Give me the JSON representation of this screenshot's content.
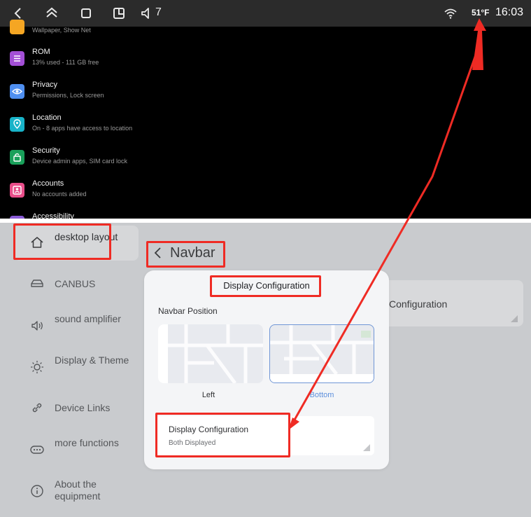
{
  "statusbar": {
    "volume_level": "7",
    "temperature": "51°F",
    "time": "16:03",
    "icons": [
      "back-icon",
      "collapse-icon",
      "recents-icon",
      "split-screen-icon",
      "volume-icon",
      "wifi-icon"
    ]
  },
  "settings_list": {
    "items": [
      {
        "title": "",
        "subtitle": "Wallpaper, Show Net",
        "icon": "display-icon",
        "color": "#f5a623"
      },
      {
        "title": "ROM",
        "subtitle": "13% used - 111 GB free",
        "icon": "storage-icon",
        "color": "#a34fd6"
      },
      {
        "title": "Privacy",
        "subtitle": "Permissions, Lock screen",
        "icon": "privacy-icon",
        "color": "#4f8ff0"
      },
      {
        "title": "Location",
        "subtitle": "On - 8 apps have access to location",
        "icon": "location-icon",
        "color": "#18b3c9"
      },
      {
        "title": "Security",
        "subtitle": "Device admin apps, SIM card lock",
        "icon": "security-icon",
        "color": "#19a05a"
      },
      {
        "title": "Accounts",
        "subtitle": "No accounts added",
        "icon": "accounts-icon",
        "color": "#e94e8a"
      },
      {
        "title": "Accessibility",
        "subtitle": "",
        "icon": "accessibility-icon",
        "color": "#8a5bd6"
      }
    ]
  },
  "sidebar": {
    "items": [
      {
        "label": "desktop layout",
        "icon": "home-icon",
        "active": true
      },
      {
        "label": "CANBUS",
        "icon": "car-icon"
      },
      {
        "label": "sound amplifier",
        "icon": "speaker-icon"
      },
      {
        "label": "Display & Theme",
        "icon": "brightness-icon"
      },
      {
        "label": "Device Links",
        "icon": "link-icon"
      },
      {
        "label": "more functions",
        "icon": "more-icon"
      },
      {
        "label": "About the equipment",
        "icon": "info-icon"
      }
    ]
  },
  "page": {
    "title": "Navbar",
    "background_card_label": "Configuration"
  },
  "dialog": {
    "title": "Display Configuration",
    "position_label": "Navbar Position",
    "options": [
      {
        "label": "Left",
        "selected": false
      },
      {
        "label": "Bottom",
        "selected": true
      }
    ],
    "config_title": "Display Configuration",
    "config_value": "Both Displayed"
  },
  "colors": {
    "annotation_red": "#ef2b24",
    "selected_blue": "#6f96d6",
    "selected_text": "#5d8fdc"
  }
}
